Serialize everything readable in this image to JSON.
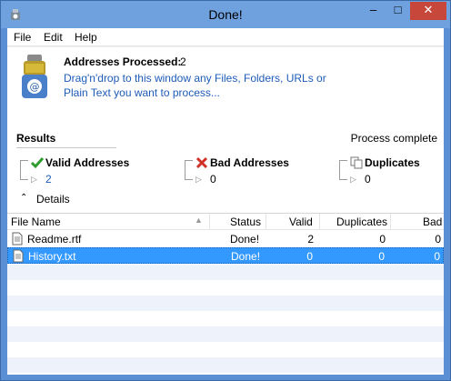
{
  "window": {
    "title": "Done!",
    "close_glyph": "✕",
    "max_glyph": "□",
    "min_glyph": "–"
  },
  "menu": {
    "file": "File",
    "edit": "Edit",
    "help": "Help"
  },
  "header": {
    "addresses_label": "Addresses Processed:",
    "addresses_count": "2",
    "instructions": "Drag'n'drop to this window any Files, Folders, URLs or Plain Text you want to process..."
  },
  "results": {
    "label": "Results",
    "status": "Process complete",
    "valid": {
      "label": "Valid Addresses",
      "count": "2",
      "icon": "check-icon"
    },
    "bad": {
      "label": "Bad Addresses",
      "count": "0",
      "icon": "x-icon"
    },
    "duplicates": {
      "label": "Duplicates",
      "count": "0",
      "icon": "copy-icon"
    },
    "details": "Details"
  },
  "table": {
    "columns": {
      "file": "File Name",
      "status": "Status",
      "valid": "Valid",
      "duplicates": "Duplicates",
      "bad": "Bad"
    },
    "rows": [
      {
        "file": "Readme.rtf",
        "status": "Done!",
        "valid": "2",
        "duplicates": "0",
        "bad": "0"
      },
      {
        "file": "History.txt",
        "status": "Done!",
        "valid": "0",
        "duplicates": "0",
        "bad": "0"
      }
    ]
  },
  "colors": {
    "titlebar": "#6fa1df",
    "selection": "#3399ff",
    "link_blue": "#1e5bb8",
    "close": "#c7473a"
  }
}
